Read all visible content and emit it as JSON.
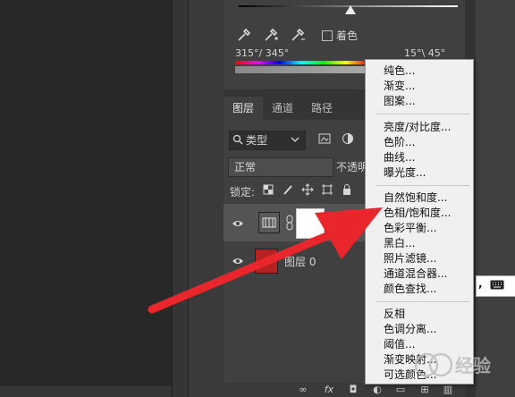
{
  "properties": {
    "colorize_label": "着色",
    "range_left": "315°/ 345°",
    "range_right": "15°\\ 45°"
  },
  "tabs": [
    {
      "label": "图层"
    },
    {
      "label": "通道"
    },
    {
      "label": "路径"
    }
  ],
  "layers_panel": {
    "filter_label": "类型",
    "blend_mode": "正常",
    "opacity_label": "不透明",
    "lock_label": "锁定:",
    "layer0_name": "图层 0"
  },
  "menu": {
    "group1": [
      "纯色...",
      "渐变...",
      "图案..."
    ],
    "group2": [
      "亮度/对比度...",
      "色阶...",
      "曲线...",
      "曝光度..."
    ],
    "group3": [
      "自然饱和度...",
      "色相/饱和度...",
      "色彩平衡...",
      "黑白...",
      "照片滤镜...",
      "通道混合器...",
      "颜色查找..."
    ],
    "group4": [
      "反相",
      "色调分离...",
      "阈值...",
      "渐变映射...",
      "可选颜色..."
    ]
  },
  "keyboard_popup": {
    "comma": ","
  },
  "watermark": {
    "text": "经验"
  },
  "colors": {
    "arrow": "#e8262b",
    "menu_bg": "#f0f0f0",
    "panel_bg": "#404040"
  }
}
